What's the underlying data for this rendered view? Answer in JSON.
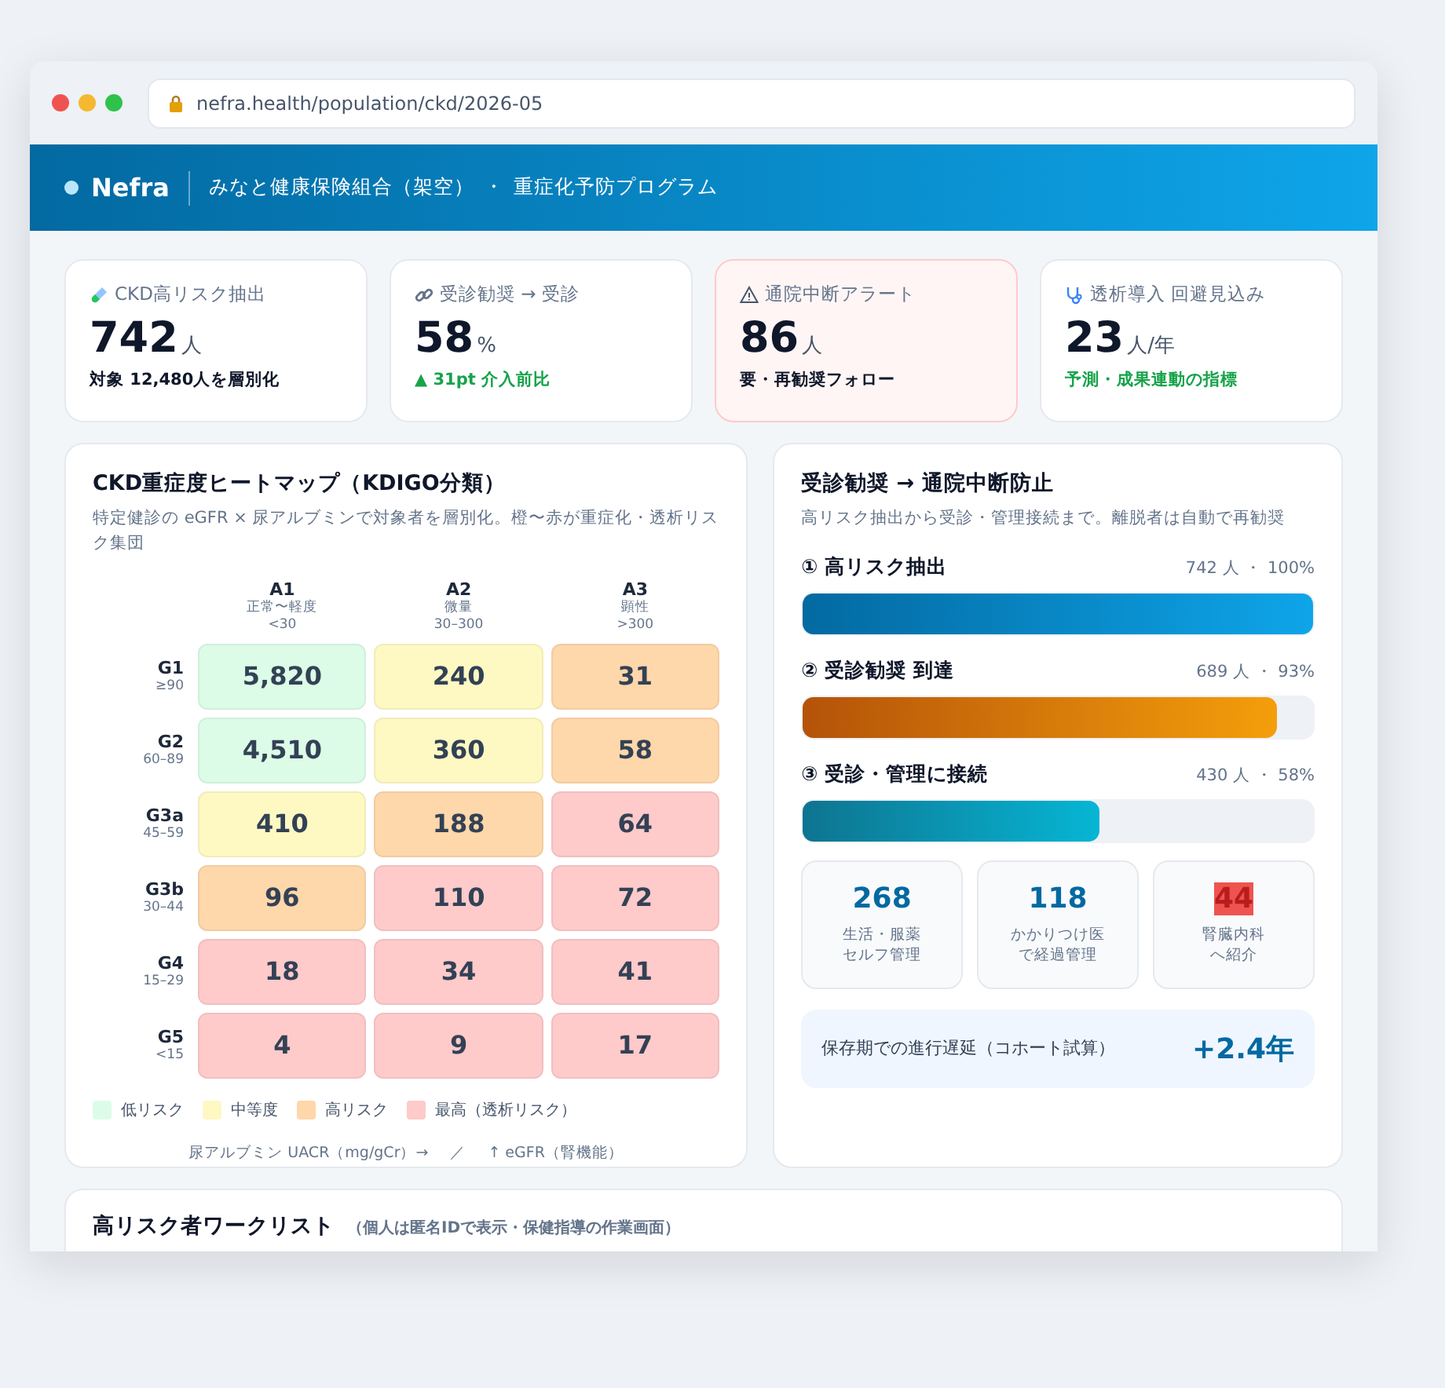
{
  "browser": {
    "url": "nefra.health/population/ckd/2026-05"
  },
  "header": {
    "brand": "Nefra",
    "org": "みなと健康保険組合（架空）",
    "separator": "・",
    "program": "重症化予防プログラム"
  },
  "kpis": [
    {
      "label": "CKD高リスク抽出",
      "value": "742",
      "unit": "人",
      "note": "対象 12,480人を層別化",
      "kind": "plain",
      "alert": false
    },
    {
      "label": "受診勧奨 → 受診",
      "value": "58",
      "unit": "%",
      "note": "▲ 31pt 介入前比",
      "kind": "positive",
      "alert": false
    },
    {
      "label": "通院中断アラート",
      "value": "86",
      "unit": "人",
      "note": "要・再勧奨フォロー",
      "kind": "plain",
      "alert": true
    },
    {
      "label": "透析導入 回避見込み",
      "value": "23",
      "unit": "人/年",
      "note": "予測・成果連動の指標",
      "kind": "positive",
      "alert": false
    }
  ],
  "heatmap": {
    "title": "CKD重症度ヒートマップ（KDIGO分類）",
    "subtitle": "特定健診の eGFR × 尿アルブミンで対象者を層別化。橙〜赤が重症化・透析リスク集団",
    "columns": [
      {
        "code": "A1",
        "name": "正常〜軽度",
        "range": "<30"
      },
      {
        "code": "A2",
        "name": "微量",
        "range": "30–300"
      },
      {
        "code": "A3",
        "name": "顕性",
        "range": ">300"
      }
    ],
    "rows": [
      {
        "code": "G1",
        "range": "≥90",
        "cells": [
          {
            "value": "5,820",
            "color": "#dcfce7"
          },
          {
            "value": "240",
            "color": "#fef9c3"
          },
          {
            "value": "31",
            "color": "#fed7aa"
          }
        ]
      },
      {
        "code": "G2",
        "range": "60–89",
        "cells": [
          {
            "value": "4,510",
            "color": "#dcfce7"
          },
          {
            "value": "360",
            "color": "#fef9c3"
          },
          {
            "value": "58",
            "color": "#fed7aa"
          }
        ]
      },
      {
        "code": "G3a",
        "range": "45–59",
        "cells": [
          {
            "value": "410",
            "color": "#fef9c3"
          },
          {
            "value": "188",
            "color": "#fed7aa"
          },
          {
            "value": "64",
            "color": "#fecaca"
          }
        ]
      },
      {
        "code": "G3b",
        "range": "30–44",
        "cells": [
          {
            "value": "96",
            "color": "#fed7aa"
          },
          {
            "value": "110",
            "color": "#fecaca"
          },
          {
            "value": "72",
            "color": "#fecaca"
          }
        ]
      },
      {
        "code": "G4",
        "range": "15–29",
        "cells": [
          {
            "value": "18",
            "color": "#fecaca"
          },
          {
            "value": "34",
            "color": "#fecaca"
          },
          {
            "value": "41",
            "color": "#fecaca"
          }
        ]
      },
      {
        "code": "G5",
        "range": "<15",
        "cells": [
          {
            "value": "4",
            "color": "#fecaca"
          },
          {
            "value": "9",
            "color": "#fecaca"
          },
          {
            "value": "17",
            "color": "#fecaca"
          }
        ]
      }
    ],
    "legend": [
      {
        "label": "低リスク",
        "color": "#dcfce7"
      },
      {
        "label": "中等度",
        "color": "#fef9c3"
      },
      {
        "label": "高リスク",
        "color": "#fed7aa"
      },
      {
        "label": "最高（透析リスク）",
        "color": "#fecaca"
      }
    ],
    "axis_note": {
      "x": "尿アルブミン UACR（mg/gCr）→",
      "separator": "／",
      "y": "↑ eGFR（腎機能）"
    }
  },
  "funnel": {
    "title": "受診勧奨 → 通院中断防止",
    "subtitle": "高リスク抽出から受診・管理接続まで。離脱者は自動で再勧奨",
    "steps": [
      {
        "label": "① 高リスク抽出",
        "reading": "742 人 ・ 100%",
        "level": 1,
        "kind": "blue"
      },
      {
        "label": "② 受診勧奨 到達",
        "reading": "689 人 ・ 93%",
        "level": 0.93,
        "kind": "orange"
      },
      {
        "label": "③ 受診・管理に接続",
        "reading": "430 人 ・ 58%",
        "level": 0.58,
        "kind": "teal"
      }
    ],
    "outcomes": [
      {
        "value": "268",
        "lines": [
          "生活・服薬",
          "セルフ管理"
        ],
        "alert": false
      },
      {
        "value": "118",
        "lines": [
          "かかりつけ医",
          "で経過管理"
        ],
        "alert": false
      },
      {
        "value": "44",
        "lines": [
          "腎臓内科",
          "へ紹介"
        ],
        "alert": true
      }
    ],
    "effect": {
      "label": "保存期での進行遅延（コホート試算）",
      "value": "+2.4年"
    }
  },
  "worklist": {
    "title": "高リスク者ワークリスト",
    "note": "（個人は匿名IDで表示・保健指導の作業画面）"
  }
}
